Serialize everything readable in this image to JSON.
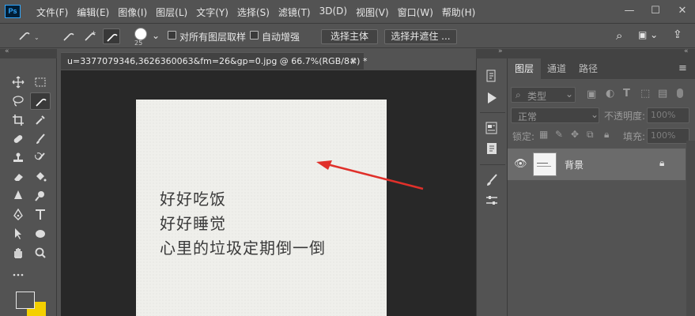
{
  "app": {
    "logo": "Ps"
  },
  "menu": [
    "文件(F)",
    "编辑(E)",
    "图像(I)",
    "图层(L)",
    "文字(Y)",
    "选择(S)",
    "滤镜(T)",
    "3D(D)",
    "视图(V)",
    "窗口(W)",
    "帮助(H)"
  ],
  "window_controls": {
    "minimize": "—",
    "maximize": "☐",
    "close": "✕"
  },
  "options": {
    "brush_size": "25",
    "sample_all_layers": "对所有图层取样",
    "auto_enhance": "自动增强",
    "select_subject": "选择主体",
    "select_and_mask": "选择并遮住 ..."
  },
  "document": {
    "tab_title": "u=3377079346,3626360063&fm=26&gp=0.jpg @ 66.7%(RGB/8#) *",
    "close": "×",
    "lines": [
      "好好吃饭",
      "好好睡觉",
      "心里的垃圾定期倒一倒"
    ]
  },
  "layers_panel": {
    "tabs": [
      "图层",
      "通道",
      "路径"
    ],
    "filter_kind": "类型",
    "blend_mode": "正常",
    "opacity_label": "不透明度:",
    "opacity_value": "100%",
    "lock_label": "锁定:",
    "fill_label": "填充:",
    "fill_value": "100%",
    "layers": [
      {
        "name": "背景",
        "locked": true
      }
    ]
  },
  "colors": {
    "accent": "#31a8ff",
    "panel": "#535353",
    "dark": "#282828",
    "arrow": "#e0302a",
    "background_swatch": "#f4d000"
  }
}
